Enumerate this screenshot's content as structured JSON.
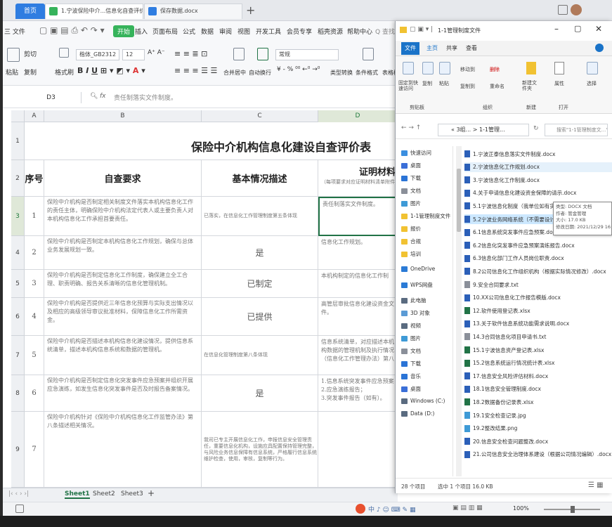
{
  "app": {
    "home_tab": "首页",
    "doc_tabs": [
      {
        "label": "1.宁波保险中介...信息化自查评价表"
      },
      {
        "label": "保存数据.docx"
      }
    ],
    "new_tab": "+"
  },
  "menu": {
    "file": "三 文件",
    "items": [
      "开始",
      "插入",
      "页面布局",
      "公式",
      "数据",
      "审阅",
      "视图",
      "开发工具",
      "会员专享",
      "稻壳资源",
      "帮助中心"
    ],
    "search": "Q 查找命令"
  },
  "ribbon": {
    "paste": "粘贴",
    "cut": "剪切",
    "copy": "复制",
    "format_painter": "格式刷",
    "font_name": "楷体_GB2312",
    "font_size": "12",
    "wrap": "自动换行",
    "merge": "合并居中",
    "number_format": "常规",
    "convert": "类型转换",
    "cond_format": "条件格式",
    "table_style": "表格样式"
  },
  "formula_bar": {
    "cell_ref": "D3",
    "fx": "fx",
    "content": "责任制落实文件制度。"
  },
  "sheet": {
    "columns": [
      "A",
      "B",
      "C",
      "D"
    ],
    "title": "保险中介机构信息化建设自查评价表",
    "headers": {
      "num": "序号",
      "req": "自查要求",
      "desc": "基本情况描述",
      "evidence": "证明材料",
      "evidence_note": "（每项要求对应证明材料清单附件）"
    },
    "rows": [
      {
        "row": "3",
        "num": "1",
        "req": "保险中介机构是否制定相关制度文件落实本机构信息化工作的责任主体，明确保险中介机构法定代表人或主要负责人对本机构信息化工作承担首要责任。",
        "desc": "已落实，在信息化工作管理制度第五条体现",
        "desc_small": true,
        "ev": "责任制落实文件制度。"
      },
      {
        "row": "4",
        "num": "2",
        "req": "保险中介机构是否制定本机构信息化工作规划，确保与总体业务发展规划一致。",
        "desc": "是",
        "desc_small": false,
        "ev": "信息化工作规划。"
      },
      {
        "row": "5",
        "num": "3",
        "req": "保险中介机构是否制定信息化工作制度，确保建立全工合理、职责明确、报告关系清晰的信息化管理机制。",
        "desc": "已制定",
        "desc_small": false,
        "ev": "本机构制定的信息化工作制"
      },
      {
        "row": "6",
        "num": "4",
        "req": "保险中介机构是否提供近三年信息化预算与实际支出情况以及相应的高级领导审议批准材料，保障信息化工作所需资金。",
        "desc": "已提供",
        "desc_small": false,
        "ev": "高管层审批信息化建设资金文件。"
      },
      {
        "row": "7",
        "num": "5",
        "req": "保险中介机构是否描述本机构信息化建设情况，提供信息系统清单，描述本机构信息系统和数据的管理机。",
        "desc": "在信息化管理制度第八条体现",
        "desc_small": true,
        "ev": "信息系统清单，对应描述本机构数据的管理机制及执行情况（信息化工作管理办法）第八"
      },
      {
        "row": "8",
        "num": "6",
        "req": "保险中介机构是否制定信息化突发事件应急预案并组织开展应急演练，如发生信息化突发事件是否及时报告备案情况。",
        "desc": "是",
        "desc_small": false,
        "ev": "1.信息系统突发事件应急预案\n2.应急演练报告；\n3.突发事件报告（如有）。"
      },
      {
        "row": "9",
        "num": "7",
        "req": "保险中介机构针对《保险中介机构信息化工作监管办法》第八条描述相关情况。",
        "desc": "我司已专主开展信息化工作，申报信息安全管理责任，重要信息化机构，设施应具配置保持管理完整，与风险业务信息保障有信息系统，严格履行信息系统维护检查，使用，审核，复制等行为。",
        "desc_small": true,
        "ev": ""
      }
    ],
    "tabs": [
      "Sheet1",
      "Sheet2",
      "Sheet3"
    ],
    "add_sheet": "+"
  },
  "statusbar": {
    "zoom": "100%"
  },
  "explorer": {
    "title": "1-1管理制度文件",
    "tabs": [
      "文件",
      "主页",
      "共享",
      "查看"
    ],
    "ribbon_groups": [
      "剪贴板",
      "组织",
      "新建",
      "打开",
      "选择"
    ],
    "ribbon_buttons": [
      "固定到快速访问",
      "复制",
      "粘贴",
      "移动到",
      "删除",
      "复制到",
      "重命名",
      "新建文件夹",
      "属性",
      "选择"
    ],
    "address": "« 3组... > 1-1管理...",
    "search_placeholder": "搜索\"1-1管理制度文...\"",
    "nav": [
      {
        "label": "快速访问",
        "color": "#3b8fe0"
      },
      {
        "label": "桌面",
        "color": "#3b6fd8"
      },
      {
        "label": "下载",
        "color": "#2b74d6"
      },
      {
        "label": "文档",
        "color": "#8a8f99"
      },
      {
        "label": "图片",
        "color": "#3e9ad6"
      },
      {
        "label": "1-1管理制度文件",
        "color": "#f1c232"
      },
      {
        "label": "报价",
        "color": "#f1c232"
      },
      {
        "label": "合规",
        "color": "#f1c232"
      },
      {
        "label": "培训",
        "color": "#f1c232"
      },
      {
        "label": "OneDrive",
        "color": "#2b7bd6"
      },
      {
        "label": "WPS网盘",
        "color": "#2b7bd6"
      },
      {
        "label": "此电脑",
        "color": "#5a6b80"
      },
      {
        "label": "3D 对象",
        "color": "#5b9bd5"
      },
      {
        "label": "视频",
        "color": "#5a6b80"
      },
      {
        "label": "图片",
        "color": "#3e9ad6"
      },
      {
        "label": "文档",
        "color": "#8a8f99"
      },
      {
        "label": "下载",
        "color": "#2b74d6"
      },
      {
        "label": "音乐",
        "color": "#2b74d6"
      },
      {
        "label": "桌面",
        "color": "#3b6fd8"
      },
      {
        "label": "Windows (C:)",
        "color": "#5a6b80"
      },
      {
        "label": "Data (D:)",
        "color": "#5a6b80"
      }
    ],
    "files": [
      {
        "name": "1.宁波正泰信息落实文件制度.docx",
        "type": "docx"
      },
      {
        "name": "2.宁波信息化工作规划.docx",
        "type": "docx"
      },
      {
        "name": "3.宁波信息化工作制度.docx",
        "type": "docx"
      },
      {
        "name": "4.关于申请信息化建设资金保障的请示.docx",
        "type": "docx"
      },
      {
        "name": "5.1宁波信息化制度（我单位如有实际需求）",
        "type": "docx"
      },
      {
        "name": "5.2宁波业务网络系统（不需要设计）",
        "type": "docx"
      },
      {
        "name": "6.1信息系统突发事件应急预案.docx",
        "type": "docx"
      },
      {
        "name": "6.2信息化突发事件应急预案演练报告.docx",
        "type": "docx"
      },
      {
        "name": "6.3信息化部门工作人员岗位职责.docx",
        "type": "docx"
      },
      {
        "name": "8.2公司信息化工作组织机构（根据实际情况修改）.docx",
        "type": "docx"
      },
      {
        "name": "9.安全合同要求.txt",
        "type": "txt"
      },
      {
        "name": "10.XX公司信息化工作报告模版.docx",
        "type": "docx"
      },
      {
        "name": "12.软件使用登记表.xlsx",
        "type": "xlsx"
      },
      {
        "name": "13.关于软件信息系统功能需求说明.docx",
        "type": "docx"
      },
      {
        "name": "14.3合同信息化项目申请书.txt",
        "type": "txt"
      },
      {
        "name": "15.1宁波信息资产登记表.xlsx",
        "type": "xlsx"
      },
      {
        "name": "15.2信息系统运行情况统计表.xlsx",
        "type": "xlsx"
      },
      {
        "name": "17.信息安全风险评估材料.docx",
        "type": "docx"
      },
      {
        "name": "18.1信息安全管理制度.docx",
        "type": "docx"
      },
      {
        "name": "18.2数据备份记录表.xlsx",
        "type": "xlsx"
      },
      {
        "name": "19.1安全检查记录.jpg",
        "type": "jpg"
      },
      {
        "name": "19.2整改结果.png",
        "type": "png"
      },
      {
        "name": "20.信息安全检查问题整改.docx",
        "type": "docx"
      },
      {
        "name": "21.公司信息安全治理体系建设（根据公司情况编辑）.docx",
        "type": "docx"
      }
    ],
    "tooltip": [
      "类型: DOCX 文档",
      "作者: 管金管理",
      "大小: 17.0 KB",
      "修改日期: 2021/12/29 16:..."
    ],
    "status": [
      "28 个项目",
      "选中 1 个项目  16.0 KB"
    ]
  },
  "colors": {
    "accent_green": "#217346",
    "wps_blue": "#2f7de1",
    "explorer_blue": "#1a73c8"
  }
}
